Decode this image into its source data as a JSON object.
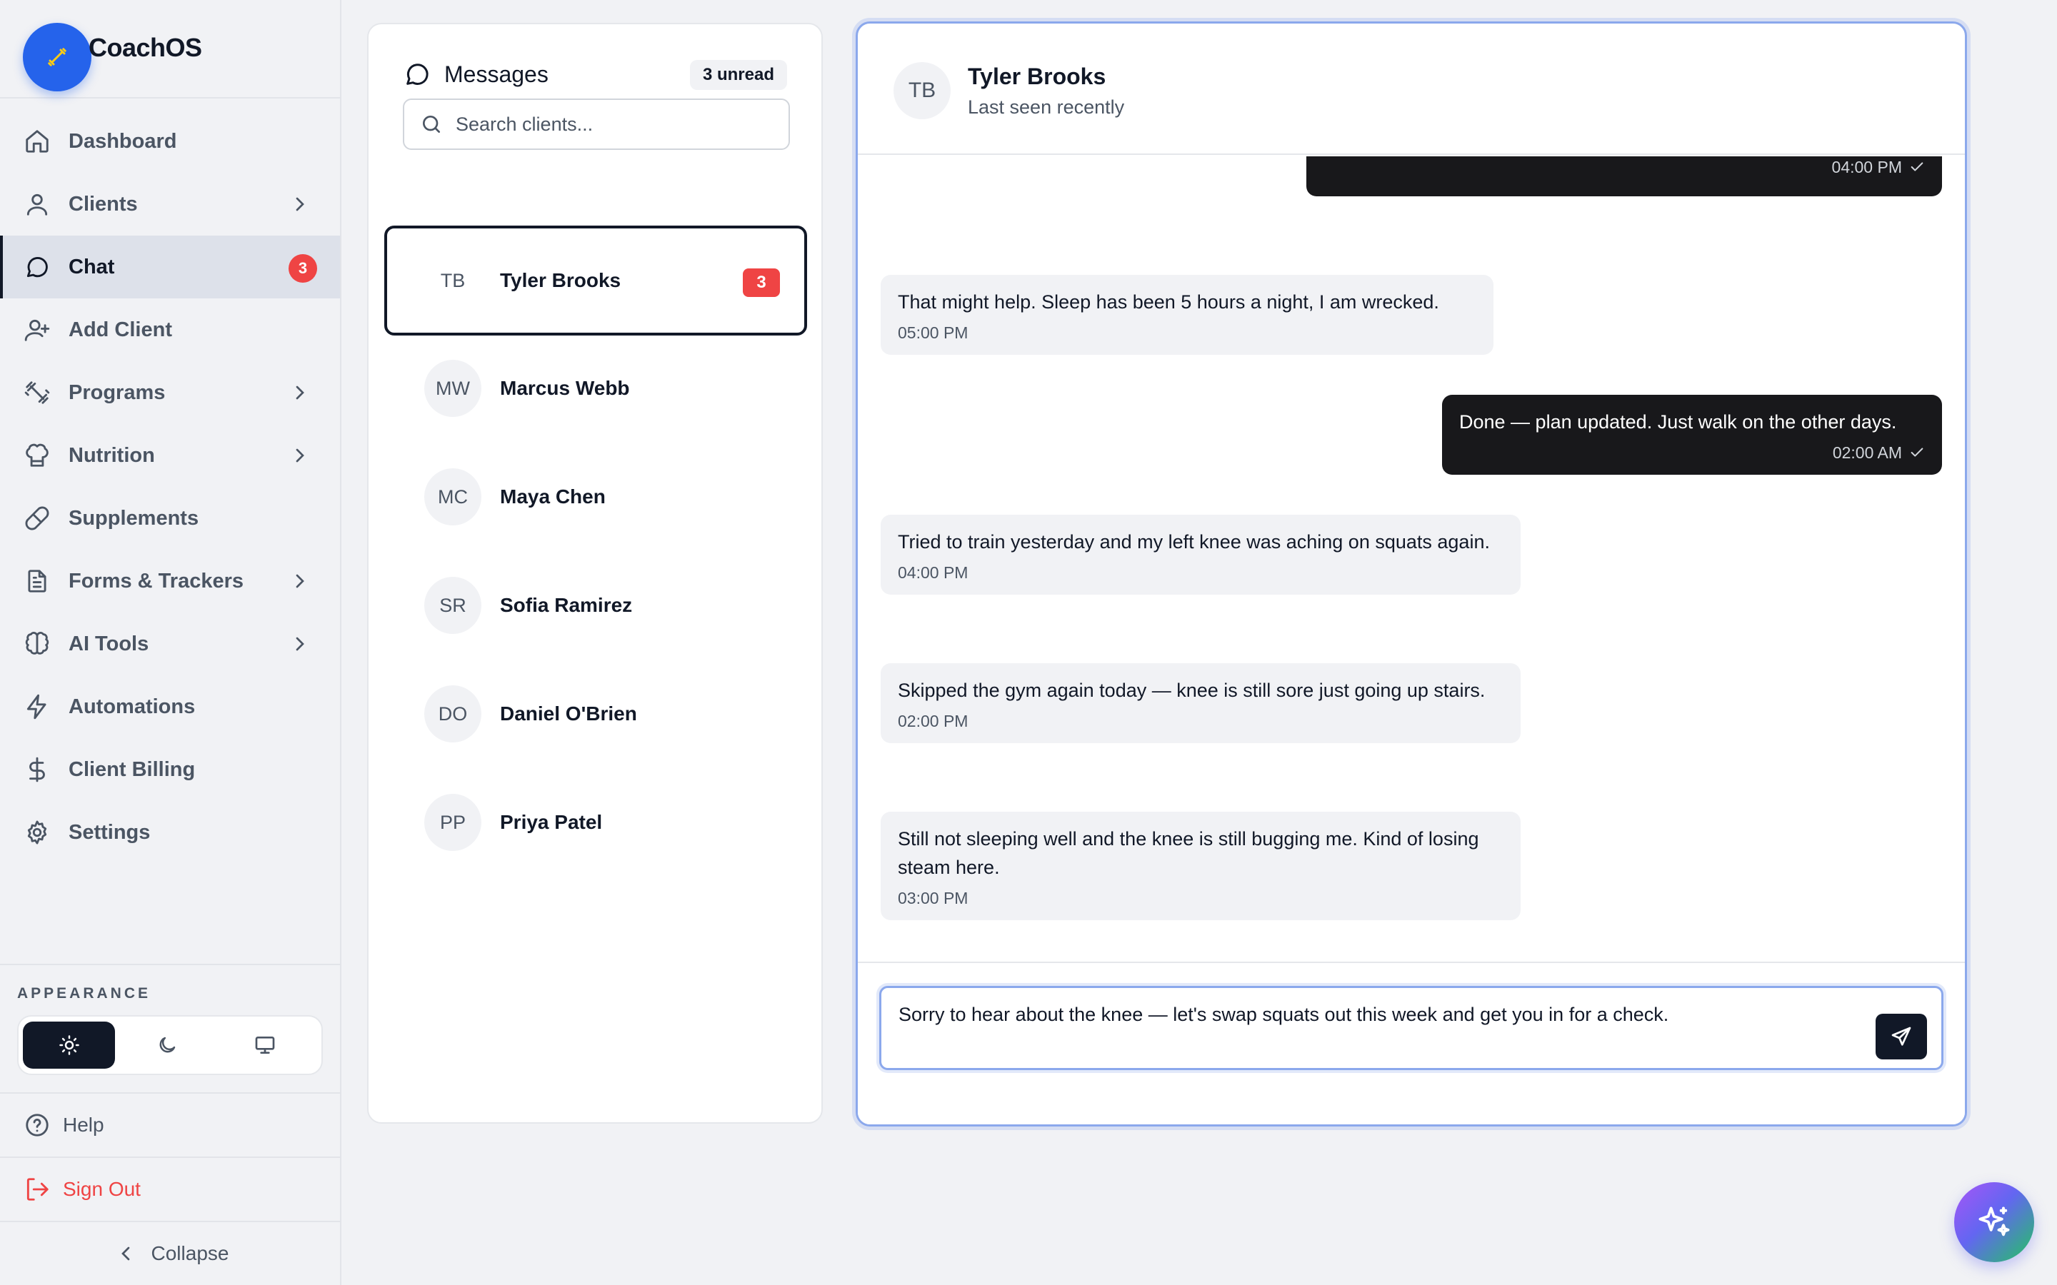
{
  "app": {
    "name": "CoachOS"
  },
  "sidebar": {
    "items": [
      {
        "label": "Dashboard",
        "icon": "home-icon"
      },
      {
        "label": "Clients",
        "icon": "user-icon",
        "chevron": true
      },
      {
        "label": "Chat",
        "icon": "chat-icon",
        "badge": "3",
        "active": true
      },
      {
        "label": "Add Client",
        "icon": "user-plus-icon"
      },
      {
        "label": "Programs",
        "icon": "dumbbell-icon",
        "chevron": true
      },
      {
        "label": "Nutrition",
        "icon": "chef-hat-icon",
        "chevron": true
      },
      {
        "label": "Supplements",
        "icon": "pill-icon"
      },
      {
        "label": "Forms & Trackers",
        "icon": "file-text-icon",
        "chevron": true
      },
      {
        "label": "AI Tools",
        "icon": "brain-icon",
        "chevron": true
      },
      {
        "label": "Automations",
        "icon": "zap-icon"
      },
      {
        "label": "Client Billing",
        "icon": "dollar-icon"
      },
      {
        "label": "Settings",
        "icon": "gear-icon"
      }
    ],
    "appearance_label": "APPEARANCE",
    "theme_options": [
      "light",
      "dark",
      "system"
    ],
    "theme_selected": "light",
    "help_label": "Help",
    "signout_label": "Sign Out",
    "collapse_label": "Collapse"
  },
  "messages_panel": {
    "title": "Messages",
    "unread_label": "3 unread",
    "search_placeholder": "Search clients...",
    "clients": [
      {
        "initials": "TB",
        "name": "Tyler Brooks",
        "badge": "3",
        "selected": true
      },
      {
        "initials": "MW",
        "name": "Marcus Webb"
      },
      {
        "initials": "MC",
        "name": "Maya Chen"
      },
      {
        "initials": "SR",
        "name": "Sofia Ramirez"
      },
      {
        "initials": "DO",
        "name": "Daniel O'Brien"
      },
      {
        "initials": "PP",
        "name": "Priya Patel"
      }
    ]
  },
  "chat": {
    "initials": "TB",
    "name": "Tyler Brooks",
    "status": "Last seen recently",
    "messages": [
      {
        "dir": "out",
        "text": "",
        "time": "04:00 PM",
        "read": true
      },
      {
        "dir": "in",
        "text": "That might help. Sleep has been 5 hours a night, I am wrecked.",
        "time": "05:00 PM"
      },
      {
        "dir": "out",
        "text": "Done — plan updated. Just walk on the other days.",
        "time": "02:00 AM",
        "read": true
      },
      {
        "dir": "in",
        "text": "Tried to train yesterday and my left knee was aching on squats again.",
        "time": "04:00 PM"
      },
      {
        "dir": "in",
        "text": "Skipped the gym again today — knee is still sore just going up stairs.",
        "time": "02:00 PM"
      },
      {
        "dir": "in",
        "text": "Still not sleeping well and the knee is still bugging me. Kind of losing steam here.",
        "time": "03:00 PM"
      }
    ],
    "composer_value": "Sorry to hear about the knee — let's swap squats out this week and get you in for a check."
  },
  "colors": {
    "accent": "#2563eb",
    "badge": "#ef4444",
    "dark": "#111827",
    "focus_ring": "#8ba8ec",
    "signout": "#ef4444"
  }
}
